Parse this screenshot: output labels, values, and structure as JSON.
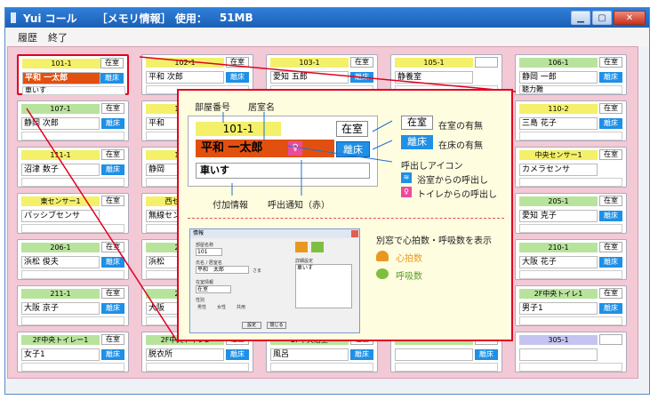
{
  "window": {
    "title": "Yui コール",
    "memory_label": "［メモリ情報］ 使用：",
    "memory_value": "51MB"
  },
  "menu": [
    "履歴",
    "終了"
  ],
  "colors": {
    "room_yellow": "#f4f06a",
    "room_green": "#b8e39c",
    "alert": "#e2500f",
    "bed_blue": "#1e90e6",
    "toilet_pink": "#ec4b9c",
    "bath_blue": "#1e90e6",
    "highlight": "#e00020"
  },
  "cards": [
    {
      "room": "101-1",
      "room_color": "yellow",
      "status": "在室",
      "name": "平和 一太郎",
      "alert": true,
      "bed": "離床",
      "extra": "車いす",
      "selected": true
    },
    {
      "room": "102-1",
      "room_color": "yellow",
      "status": "在室",
      "name": "平和 次郎",
      "alert": false,
      "bed": "離床",
      "extra": ""
    },
    {
      "room": "103-1",
      "room_color": "yellow",
      "status": "在室",
      "name": "愛知 五郎",
      "alert": false,
      "bed": "離床",
      "extra": ""
    },
    {
      "room": "105-1",
      "room_color": "yellow",
      "status": "",
      "name": "静養室",
      "alert": false,
      "bed": "",
      "extra": ""
    },
    {
      "room": "106-1",
      "room_color": "green",
      "status": "在室",
      "name": "静岡 一郎",
      "alert": false,
      "bed": "離床",
      "extra": "聴力難"
    },
    {
      "room": "107-1",
      "room_color": "green",
      "status": "在室",
      "name": "静岡 次郎",
      "alert": false,
      "bed": "離床",
      "extra": ""
    },
    {
      "room": "108-1",
      "room_color": "yellow",
      "status": "在室",
      "name": "平和",
      "alert": false,
      "bed": "",
      "extra": ""
    },
    {
      "room": "",
      "room_color": "yellow",
      "status": "",
      "name": "",
      "alert": false,
      "bed": "",
      "extra": ""
    },
    {
      "room": "",
      "room_color": "yellow",
      "status": "",
      "name": "",
      "alert": false,
      "bed": "",
      "extra": ""
    },
    {
      "room": "110-2",
      "room_color": "yellow",
      "status": "在室",
      "name": "三島 花子",
      "alert": false,
      "bed": "離床",
      "extra": ""
    },
    {
      "room": "111-1",
      "room_color": "yellow",
      "status": "在室",
      "name": "沼津 数子",
      "alert": false,
      "bed": "離床",
      "extra": ""
    },
    {
      "room": "112-1",
      "room_color": "yellow",
      "status": "在室",
      "name": "静岡",
      "alert": false,
      "bed": "",
      "extra": ""
    },
    {
      "room": "",
      "room_color": "yellow",
      "status": "",
      "name": "",
      "alert": false,
      "bed": "",
      "extra": ""
    },
    {
      "room": "",
      "room_color": "yellow",
      "status": "",
      "name": "",
      "alert": false,
      "bed": "",
      "extra": ""
    },
    {
      "room": "中央センサー1",
      "room_color": "yellow",
      "status": "在室",
      "name": "カメラセンサ",
      "alert": false,
      "bed": "",
      "extra": ""
    },
    {
      "room": "東センサー1",
      "room_color": "yellow",
      "status": "在室",
      "name": "パッシブセンサ",
      "alert": false,
      "bed": "",
      "extra": ""
    },
    {
      "room": "西センサー1",
      "room_color": "yellow",
      "status": "在室",
      "name": "無線センサ",
      "alert": false,
      "bed": "",
      "extra": ""
    },
    {
      "room": "",
      "room_color": "yellow",
      "status": "",
      "name": "",
      "alert": false,
      "bed": "",
      "extra": ""
    },
    {
      "room": "",
      "room_color": "yellow",
      "status": "",
      "name": "",
      "alert": false,
      "bed": "",
      "extra": ""
    },
    {
      "room": "205-1",
      "room_color": "green",
      "status": "在室",
      "name": "愛知 克子",
      "alert": false,
      "bed": "離床",
      "extra": ""
    },
    {
      "room": "206-1",
      "room_color": "green",
      "status": "在室",
      "name": "浜松 俊夫",
      "alert": false,
      "bed": "離床",
      "extra": ""
    },
    {
      "room": "207-1",
      "room_color": "green",
      "status": "在室",
      "name": "浜松",
      "alert": false,
      "bed": "離床",
      "extra": ""
    },
    {
      "room": "",
      "room_color": "yellow",
      "status": "",
      "name": "",
      "alert": false,
      "bed": "",
      "extra": ""
    },
    {
      "room": "",
      "room_color": "yellow",
      "status": "",
      "name": "",
      "alert": false,
      "bed": "",
      "extra": ""
    },
    {
      "room": "210-1",
      "room_color": "green",
      "status": "在室",
      "name": "大阪 花子",
      "alert": false,
      "bed": "離床",
      "extra": ""
    },
    {
      "room": "211-1",
      "room_color": "green",
      "status": "在室",
      "name": "大阪 京子",
      "alert": false,
      "bed": "離床",
      "extra": ""
    },
    {
      "room": "212-1",
      "room_color": "green",
      "status": "在室",
      "name": "大阪",
      "alert": false,
      "bed": "離床",
      "extra": ""
    },
    {
      "room": "",
      "room_color": "yellow",
      "status": "",
      "name": "",
      "alert": false,
      "bed": "",
      "extra": ""
    },
    {
      "room": "",
      "room_color": "yellow",
      "status": "",
      "name": "",
      "alert": false,
      "bed": "",
      "extra": ""
    },
    {
      "room": "2F中央トイレ1",
      "room_color": "green",
      "status": "在室",
      "name": "男子1",
      "alert": false,
      "bed": "離床",
      "extra": ""
    },
    {
      "room": "2F中央トイレー1",
      "room_color": "green",
      "status": "在室",
      "name": "女子1",
      "alert": false,
      "bed": "離床",
      "extra": ""
    },
    {
      "room": "2F中央トイレ2",
      "room_color": "green",
      "status": "在室",
      "name": "脱衣所",
      "alert": false,
      "bed": "離床",
      "extra": ""
    },
    {
      "room": "2F中央浴室",
      "room_color": "green",
      "status": "在室",
      "name": "風呂",
      "alert": false,
      "bed": "離床",
      "extra": ""
    },
    {
      "room": "",
      "room_color": "green",
      "status": "",
      "name": "",
      "alert": false,
      "bed": "離床",
      "extra": ""
    },
    {
      "room": "305-1",
      "room_color": "purple",
      "status": "",
      "name": "",
      "alert": false,
      "bed": "",
      "extra": ""
    }
  ],
  "popup": {
    "room": "101-1",
    "status": "在室",
    "name": "平和 一太郎",
    "bed": "離床",
    "extra": "車いす",
    "labels": {
      "room_no": "部屋番号",
      "resident": "居室名",
      "status_desc": "在室の有無",
      "bed_desc": "在床の有無",
      "call_icon": "呼出しアイコン",
      "bath_call": "浴室からの呼出し",
      "toilet_call": "トイレからの呼出し",
      "extra_info": "付加情報",
      "call_notice": "呼出通知（赤）",
      "vitals": "別窓で心拍数・呼吸数を表示",
      "heart": "心拍数",
      "breath": "呼吸数"
    },
    "legend_status": "在室",
    "legend_bed": "離床",
    "dialog": {
      "title": "情報",
      "room_label": "部屋名称",
      "room_value": "101",
      "name_label": "氏名 / 居室名",
      "name_value": "平和　太郎",
      "name_suffix": "さま",
      "status_label": "在室情報",
      "status_value": "在室",
      "gender_label": "性別",
      "gender_options": [
        "男性",
        "女性",
        "共用"
      ],
      "note_label": "詳細設定",
      "note_value": "車いす",
      "ok": "設定",
      "cancel": "閉じる"
    }
  }
}
